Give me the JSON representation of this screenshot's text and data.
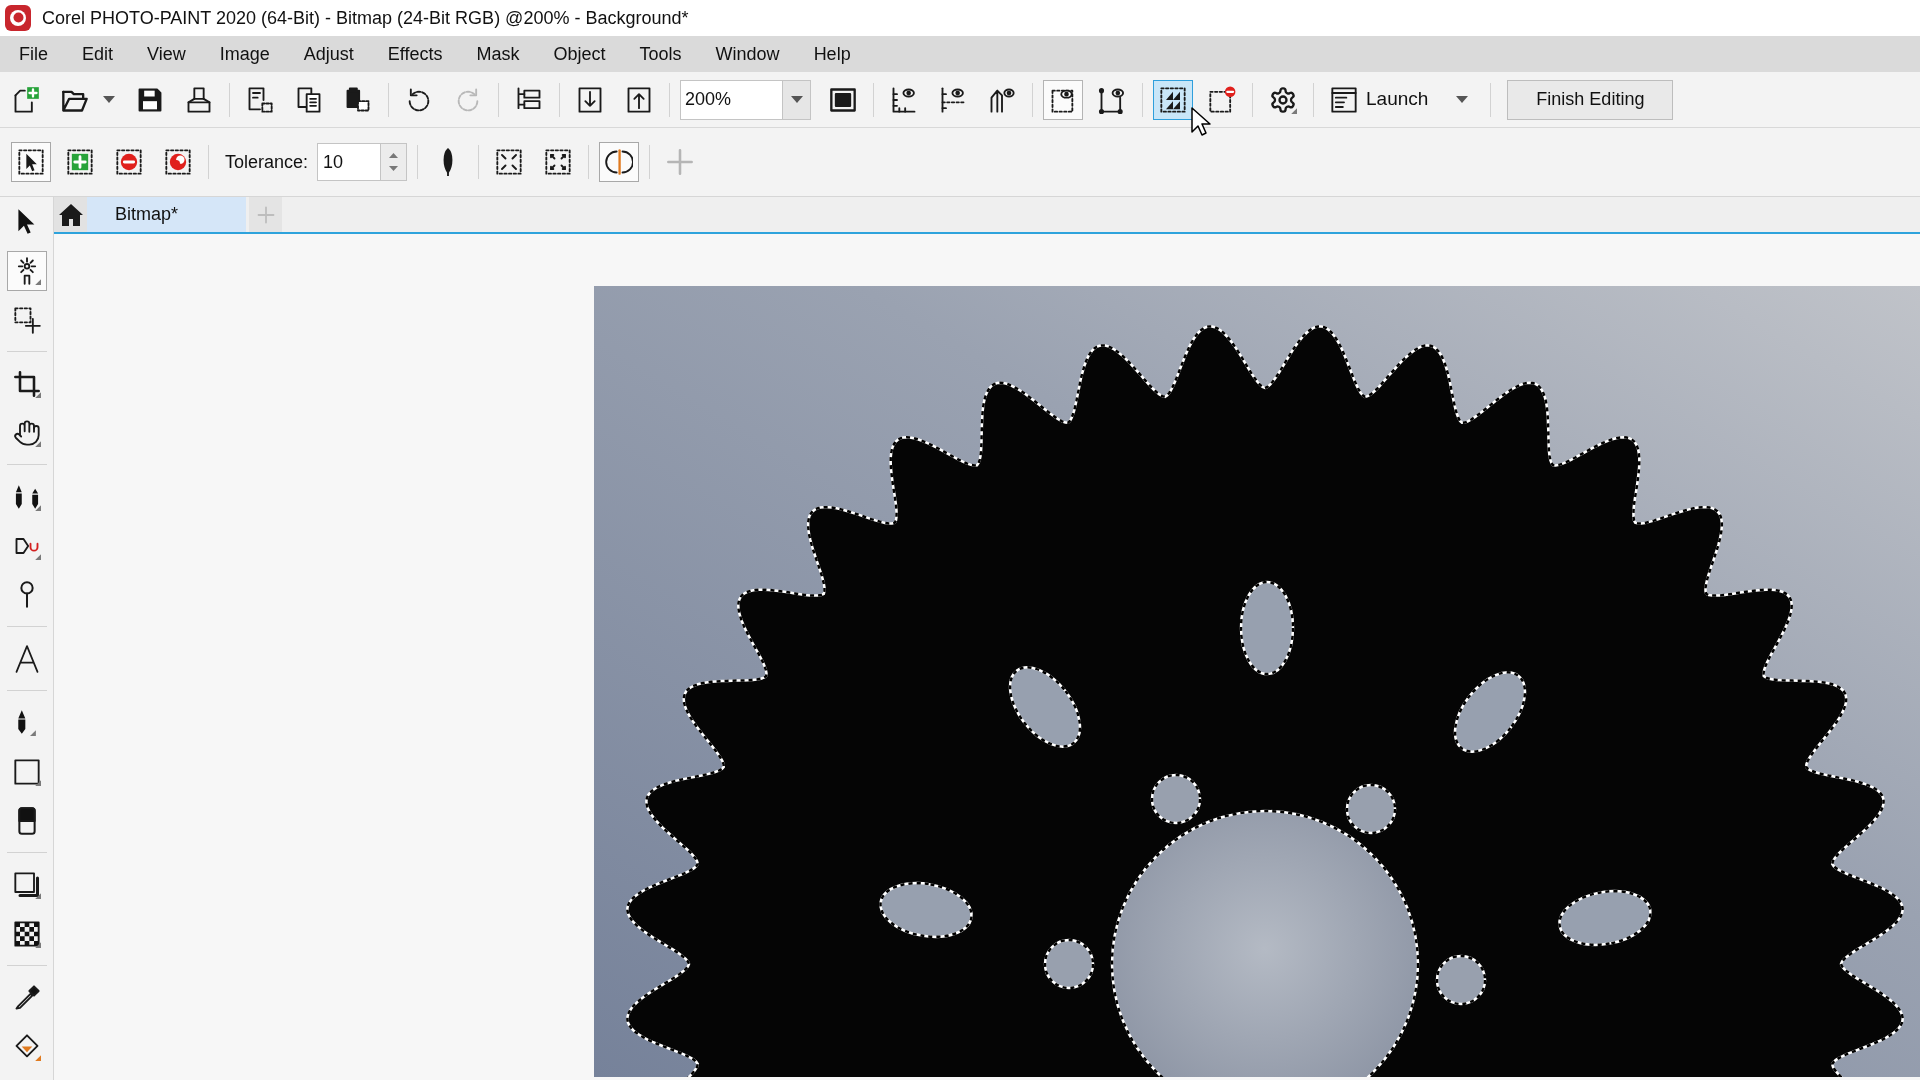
{
  "window": {
    "title": "Corel PHOTO-PAINT 2020 (64-Bit) - Bitmap (24-Bit RGB) @200% - Background*"
  },
  "menu": [
    {
      "label": "File"
    },
    {
      "label": "Edit"
    },
    {
      "label": "View"
    },
    {
      "label": "Image"
    },
    {
      "label": "Adjust"
    },
    {
      "label": "Effects"
    },
    {
      "label": "Mask"
    },
    {
      "label": "Object"
    },
    {
      "label": "Tools"
    },
    {
      "label": "Window"
    },
    {
      "label": "Help"
    }
  ],
  "standard_toolbar": {
    "history_buttons": [
      {
        "disabled": false
      },
      {
        "disabled": true
      }
    ],
    "zoom_box": {
      "value": "200%"
    },
    "view_buttons": [
      {
        "pressed": false,
        "hovered": false
      },
      {
        "pressed": false,
        "hovered": false
      },
      {
        "pressed": false,
        "hovered": false
      },
      {
        "pressed": true,
        "hovered": false
      },
      {
        "pressed": false,
        "hovered": false
      },
      {
        "pressed": false,
        "hovered": true
      },
      {
        "pressed": false,
        "hovered": false
      }
    ],
    "launch_button": {
      "label": "Launch"
    },
    "finish_button": {
      "label": "Finish Editing"
    }
  },
  "property_bar": {
    "mode_buttons": [
      {
        "selected": true
      },
      {
        "selected": false
      },
      {
        "selected": false
      },
      {
        "selected": false
      }
    ],
    "tolerance": {
      "label": "Tolerance:",
      "value": "10"
    },
    "toggle_button": {
      "pressed": true
    },
    "add_button": {
      "disabled": true
    }
  },
  "toolbox": {
    "tools": [
      {
        "selected": false
      },
      {
        "selected": true
      },
      {
        "selected": false
      },
      {
        "selected": false
      },
      {
        "selected": false
      },
      {
        "selected": false
      },
      {
        "selected": false
      },
      {
        "selected": false
      },
      {
        "selected": false
      },
      {
        "selected": false
      },
      {
        "selected": false
      },
      {
        "selected": false
      },
      {
        "selected": false
      },
      {
        "selected": false
      },
      {
        "selected": false
      },
      {
        "selected": false
      }
    ]
  },
  "document_tabs": [
    {
      "label": "Bitmap*",
      "selected": true
    }
  ]
}
